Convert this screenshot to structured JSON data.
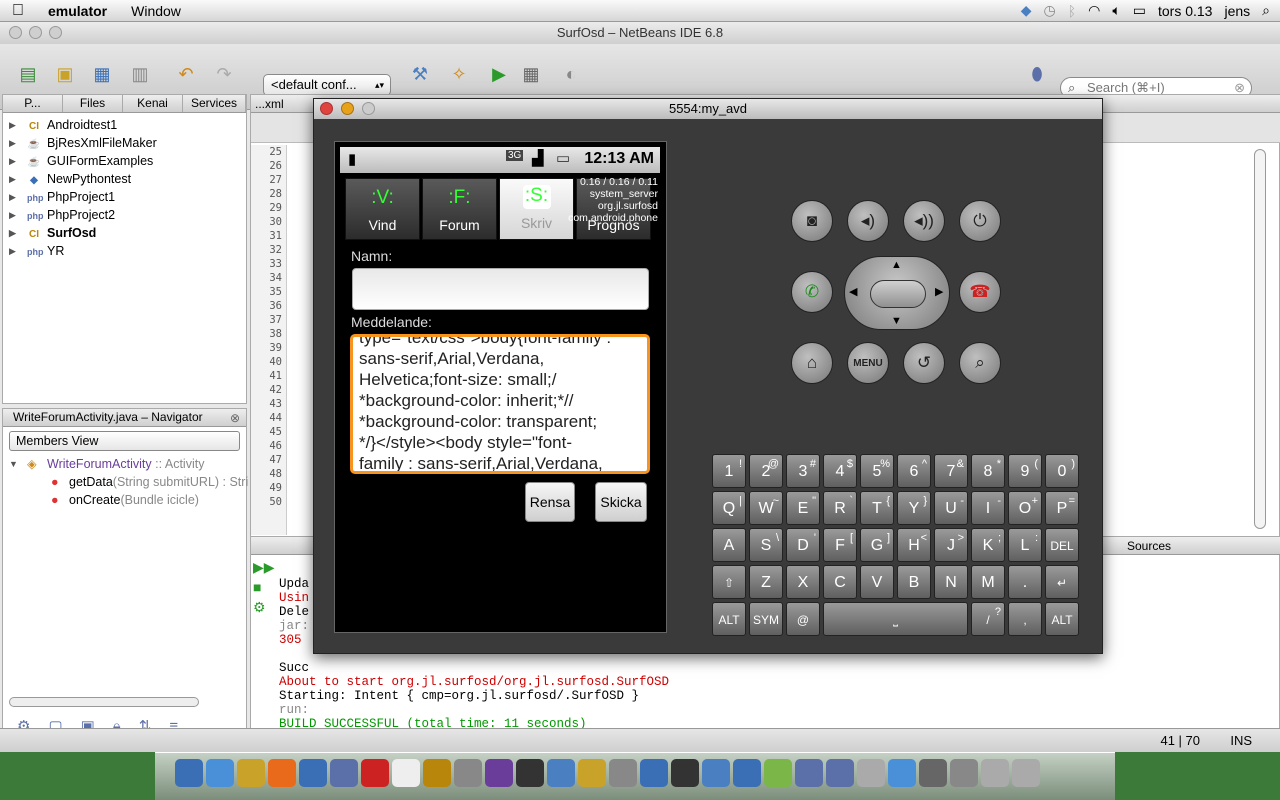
{
  "menubar": {
    "app": "emulator",
    "items": [
      "Window"
    ],
    "clock": "tors 0.13",
    "user": "jens"
  },
  "ide": {
    "title": "SurfOsd – NetBeans IDE 6.8",
    "config": "<default conf...",
    "search_placeholder": "Search (⌘+I)"
  },
  "projects": {
    "tabs": [
      "P...",
      "Files",
      "Kenai",
      "Services"
    ],
    "items": [
      {
        "label": "Androidtest1",
        "icon": "CI"
      },
      {
        "label": "BjResXmlFileMaker",
        "icon": "cup"
      },
      {
        "label": "GUIFormExamples",
        "icon": "cup"
      },
      {
        "label": "NewPythontest",
        "icon": "py"
      },
      {
        "label": "PhpProject1",
        "icon": "php"
      },
      {
        "label": "PhpProject2",
        "icon": "php"
      },
      {
        "label": "SurfOsd",
        "icon": "CI"
      },
      {
        "label": "YR",
        "icon": "php"
      }
    ]
  },
  "navigator": {
    "title": "WriteForumActivity.java – Navigator",
    "view": "Members View",
    "class_label": "WriteForumActivity",
    "class_extends": ":: Activity",
    "method1_name": "getData",
    "method1_params": "(String submitURL) : Stri",
    "method2_name": "onCreate",
    "method2_params": "(Bundle icicle)"
  },
  "editor": {
    "tab": "...xml",
    "line_numbers": [
      "25",
      "26",
      "27",
      "28",
      "29",
      "30",
      "31",
      "32",
      "33",
      "34",
      "35",
      "36",
      "37",
      "38",
      "39",
      "40",
      "41",
      "42",
      "43",
      "44",
      "45",
      "46",
      "47",
      "48",
      "49",
      "50"
    ]
  },
  "output": {
    "sources_tab": "Sources",
    "lines": [
      {
        "text": "Upda",
        "color": "#000"
      },
      {
        "text": "Usin",
        "color": "#c00"
      },
      {
        "text": "Dele",
        "color": "#000"
      },
      {
        "text": "jar:",
        "color": "#888"
      },
      {
        "text": "305 ",
        "color": "#c00"
      },
      {
        "text": "",
        "color": "#000"
      },
      {
        "text": "Succ",
        "color": "#000"
      },
      {
        "text": "About to start org.jl.surfosd/org.jl.surfosd.SurfOSD",
        "color": "#c00"
      },
      {
        "text": "Starting: Intent { cmp=org.jl.surfosd/.SurfOSD }",
        "color": "#000"
      },
      {
        "text": "run:",
        "color": "#888"
      },
      {
        "text": "BUILD SUCCESSFUL (total time: 11 seconds)",
        "color": "#090"
      }
    ]
  },
  "statusbar": {
    "position": "41 | 70",
    "mode": "INS"
  },
  "emulator": {
    "title": "5554:my_avd",
    "clock": "12:13 AM",
    "network": "3G",
    "tabs": [
      {
        "icon": ":V:",
        "label": "Vind"
      },
      {
        "icon": ":F:",
        "label": "Forum"
      },
      {
        "icon": ":S:",
        "label": "Skriv"
      },
      {
        "icon": "",
        "label": "Prognos"
      }
    ],
    "cpu_lines": [
      "0.16 / 0.16 / 0.11",
      "system_server",
      "org.jl.surfosd",
      "com.android.phone"
    ],
    "name_label": "Namn:",
    "name_value": "",
    "message_label": "Meddelande:",
    "message_lines": [
      "type=\"text/css\">body{font-family :",
      "sans-serif,Arial,Verdana,",
      "Helvetica;font-size: small;/",
      "*background-color: inherit;*//",
      "*background-color: transparent;",
      "*/}</style><body style=\"font-",
      "family : sans-serif,Arial,Verdana,"
    ],
    "clear_button": "Rensa",
    "send_button": "Skicka",
    "menu_key": "MENU"
  },
  "keyboard": {
    "row1": [
      [
        "1",
        "!"
      ],
      [
        "2",
        "@"
      ],
      [
        "3",
        "#"
      ],
      [
        "4",
        "$"
      ],
      [
        "5",
        "%"
      ],
      [
        "6",
        "^"
      ],
      [
        "7",
        "&"
      ],
      [
        "8",
        "*"
      ],
      [
        "9",
        "("
      ],
      [
        "0",
        ")"
      ]
    ],
    "row2": [
      [
        "Q",
        "|"
      ],
      [
        "W",
        "~"
      ],
      [
        "E",
        "\""
      ],
      [
        "R",
        "`"
      ],
      [
        "T",
        "{"
      ],
      [
        "Y",
        "}"
      ],
      [
        "U",
        "-"
      ],
      [
        "I",
        "-"
      ],
      [
        "O",
        "+"
      ],
      [
        "P",
        "="
      ]
    ],
    "row3": [
      [
        "A",
        ""
      ],
      [
        "S",
        "\\"
      ],
      [
        "D",
        "'"
      ],
      [
        "F",
        "["
      ],
      [
        "G",
        "]"
      ],
      [
        "H",
        "<"
      ],
      [
        "J",
        ">"
      ],
      [
        "K",
        ";"
      ],
      [
        "L",
        ":"
      ]
    ],
    "row4": [
      "Z",
      "X",
      "C",
      "V",
      "B",
      "N",
      "M",
      "."
    ],
    "del": "DEL",
    "alt": "ALT",
    "sym": "SYM",
    "at": "@",
    "slash": "/",
    "slash_sup": "?",
    "comma": ","
  }
}
